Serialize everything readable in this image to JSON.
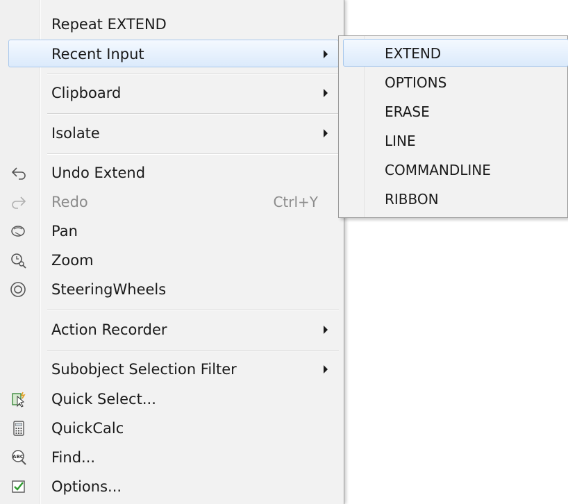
{
  "menu": {
    "items": [
      {
        "label": "Repeat EXTEND"
      },
      {
        "label": "Recent Input"
      },
      {
        "label": "Clipboard"
      },
      {
        "label": "Isolate"
      },
      {
        "label": "Undo Extend"
      },
      {
        "label": "Redo",
        "shortcut": "Ctrl+Y"
      },
      {
        "label": "Pan"
      },
      {
        "label": "Zoom"
      },
      {
        "label": "SteeringWheels"
      },
      {
        "label": "Action Recorder"
      },
      {
        "label": "Subobject Selection Filter"
      },
      {
        "label": "Quick Select..."
      },
      {
        "label": "QuickCalc"
      },
      {
        "label": "Find..."
      },
      {
        "label": "Options..."
      }
    ]
  },
  "submenu": {
    "items": [
      {
        "label": "EXTEND"
      },
      {
        "label": "OPTIONS"
      },
      {
        "label": "ERASE"
      },
      {
        "label": "LINE"
      },
      {
        "label": "COMMANDLINE"
      },
      {
        "label": "RIBBON"
      }
    ]
  },
  "icons": {
    "undo": "undo-arrow-icon",
    "redo": "redo-arrow-icon",
    "pan": "pan-hand-icon",
    "zoom": "zoom-magnifier-icon",
    "steering": "steering-wheel-icon",
    "quick_select": "quick-select-icon",
    "calc": "calculator-icon",
    "find": "find-abc-icon",
    "options": "options-checkbox-icon"
  },
  "colors": {
    "highlight_border": "#a8c8ec",
    "highlight_fill": "#dbeafb",
    "menu_bg": "#f2f2f2",
    "disabled_text": "#8c8c8c"
  }
}
